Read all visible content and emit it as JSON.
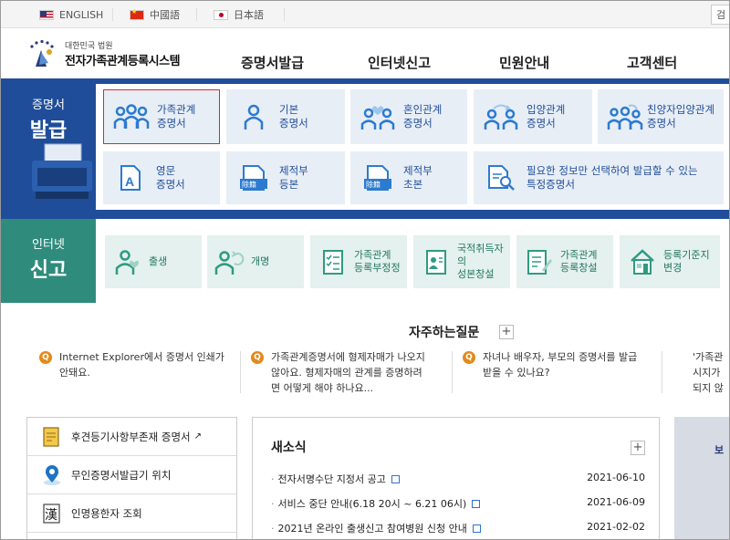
{
  "lang_bar": {
    "languages": [
      {
        "label": "ENGLISH",
        "flag": "us-flag-icon"
      },
      {
        "label": "中國語",
        "flag": "china-flag-icon"
      },
      {
        "label": "日本語",
        "flag": "japan-flag-icon"
      }
    ],
    "search_tab": "검"
  },
  "header": {
    "logo_sub": "대한민국 법원",
    "logo_main": "전자가족관계등록시스템",
    "nav": [
      "증명서발급",
      "인터넷신고",
      "민원안내",
      "고객센터"
    ]
  },
  "certificates": {
    "title_small": "증명서",
    "title_big": "발급",
    "items": [
      {
        "line1": "가족관계",
        "line2": "증명서",
        "icon": "family-icon",
        "highlighted": true
      },
      {
        "line1": "기본",
        "line2": "증명서",
        "icon": "person-icon"
      },
      {
        "line1": "혼인관계",
        "line2": "증명서",
        "icon": "couple-heart-icon"
      },
      {
        "line1": "입양관계",
        "line2": "증명서",
        "icon": "adoption-icon"
      },
      {
        "line1": "친양자입양관계",
        "line2": "증명서",
        "icon": "full-adoption-icon"
      },
      {
        "line1": "영문",
        "line2": "증명서",
        "icon": "english-document-icon"
      },
      {
        "line1": "제적부",
        "line2": "등본",
        "icon": "removed-register-icon",
        "badge": "除籍"
      },
      {
        "line1": "제적부",
        "line2": "초본",
        "icon": "removed-register-icon",
        "badge": "除籍"
      },
      {
        "line1": "필요한 정보만 선택하여 발급할 수 있는",
        "line2": "특정증명서",
        "icon": "magnifier-document-icon"
      }
    ]
  },
  "report": {
    "title_small": "인터넷",
    "title_big": "신고",
    "items": [
      {
        "line1": "출생",
        "line2": "",
        "icon": "birth-icon"
      },
      {
        "line1": "개명",
        "line2": "",
        "icon": "rename-icon"
      },
      {
        "line1": "가족관계",
        "line2": "등록부정정",
        "icon": "checklist-icon"
      },
      {
        "line1": "국적취득자의",
        "line2": "성본창설",
        "icon": "id-card-icon"
      },
      {
        "line1": "가족관계",
        "line2": "등록창설",
        "icon": "document-pen-icon"
      },
      {
        "line1": "등록기준지",
        "line2": "변경",
        "icon": "house-icon"
      }
    ]
  },
  "faq": {
    "title": "자주하는질문",
    "items": [
      {
        "l1": "Internet Explorer에서 증명서 인쇄가",
        "l2": "안돼요.",
        "l3": ""
      },
      {
        "l1": "가족관계증명서에 형제자매가 나오지",
        "l2": "않아요. 형제자매의 관계를 증명하려",
        "l3": "면 어떻게 해야 하나요..."
      },
      {
        "l1": "자녀나 배우자, 부모의 증명서를 발급",
        "l2": "받을 수 있나요?",
        "l3": ""
      },
      {
        "l1": "'가족관",
        "l2": "시지가",
        "l3": "되지 않"
      }
    ]
  },
  "quick_links": [
    {
      "label": "후견등기사항부존재 증명서",
      "icon": "certificate-doc-icon",
      "external": true
    },
    {
      "label": "무인증명서발급기 위치",
      "icon": "location-pin-icon"
    },
    {
      "label": "인명용한자 조회",
      "icon": "hanja-book-icon",
      "glyph": "漢"
    }
  ],
  "news": {
    "title": "새소식",
    "items": [
      {
        "text": "전자서명수단 지정서 공고",
        "date": "2021-06-10"
      },
      {
        "text": "서비스 중단 안내(6.18 20시 ~ 6.21 06시)",
        "date": "2021-06-09"
      },
      {
        "text": "2021년 온라인 출생신고 참여병원 신청 안내",
        "date": "2021-02-02"
      }
    ]
  },
  "banner": {
    "text": "보"
  },
  "colors": {
    "cert_band": "#1f4d99",
    "report_band": "#2f8c7c",
    "faq_q": "#e28a1c",
    "highlight": "#d62b2b"
  }
}
